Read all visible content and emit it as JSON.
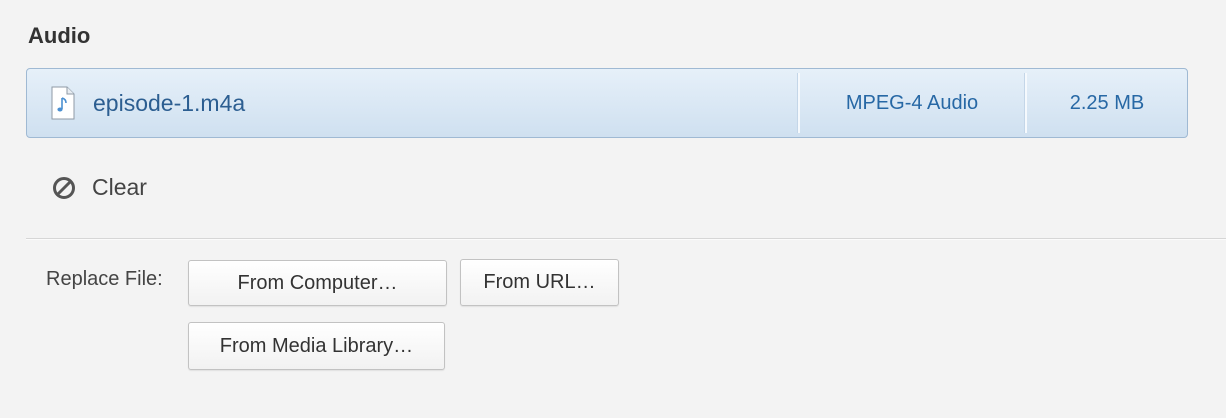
{
  "section": {
    "title": "Audio"
  },
  "file": {
    "icon": "audio-file-icon",
    "name": "episode-1.m4a",
    "type": "MPEG-4 Audio",
    "size": "2.25 MB"
  },
  "clear": {
    "icon": "clear-icon",
    "label": "Clear"
  },
  "replace": {
    "label": "Replace File:",
    "buttons": {
      "from_computer": "From Computer…",
      "from_url": "From URL…",
      "from_media_library": "From Media Library…"
    }
  },
  "colors": {
    "background": "#f3f3f3",
    "row_highlight": "#d8e7f5",
    "row_border": "#9fb9d3",
    "accent_text": "#2768a5"
  }
}
